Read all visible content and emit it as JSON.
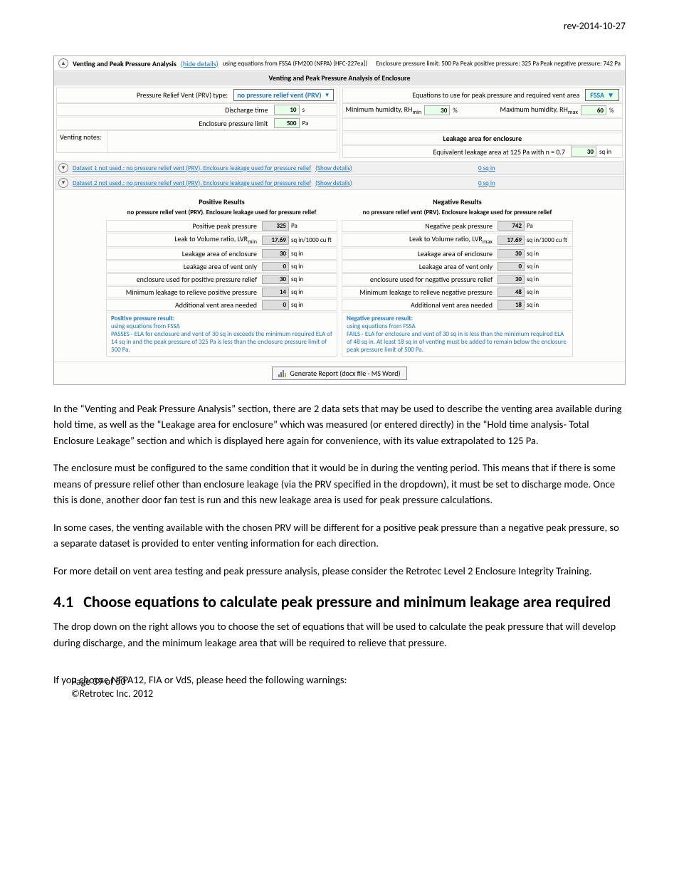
{
  "header": {
    "rev": "rev-2014-10-27"
  },
  "panel": {
    "titlebar": {
      "title": "Venting and Peak Pressure Analysis",
      "hide": "(hide details)",
      "eq_note": "using equations from FSSA (FM200 (NFPA) [HFC-227ea])",
      "summary": "Enclosure pressure limit: 500 Pa  Peak positive pressure: 325 Pa  Peak negative pressure: 742 Pa"
    },
    "banner": "Venting and Peak Pressure Analysis of Enclosure",
    "left": {
      "prv_label": "Pressure Relief Vent (PRV) type:",
      "prv_dropdown": "no pressure relief vent (PRV)",
      "discharge_label": "Discharge time",
      "discharge_val": "10",
      "discharge_unit": "s",
      "encl_label": "Enclosure pressure limit",
      "encl_val": "500",
      "encl_unit": "Pa",
      "venting_notes": "Venting notes:"
    },
    "right": {
      "eq_use_label": "Equations to use for peak pressure and required vent area",
      "eq_use_val": "FSSA",
      "min_rh_label": "Minimum humidity, RH",
      "min_rh_sub": "min",
      "min_rh_val": "30",
      "min_rh_unit": "%",
      "max_rh_label": "Maximum humidity, RH",
      "max_rh_sub": "max",
      "max_rh_val": "60",
      "max_rh_unit": "%",
      "leak_heading": "Leakage area for enclosure",
      "ela_label": "Equivalent leakage area at 125 Pa with n = 0.7",
      "ela_val": "30",
      "ela_unit": "sq in"
    },
    "datasets": {
      "d1": "Dataset 1 not used.: no pressure relief vent (PRV). Enclosure leakage used for pressure relief",
      "d2": "Dataset 2 not used.: no pressure relief vent (PRV). Enclosure leakage used for pressure relief",
      "show": "(Show details)",
      "zero": "0 sq in"
    },
    "results": {
      "pos_title": "Positive Results",
      "neg_title": "Negative Results",
      "sub": "no pressure relief vent (PRV). Enclosure leakage used for pressure relief",
      "pos": {
        "rows": [
          {
            "l": "Positive peak pressure",
            "v": "325",
            "u": "Pa"
          },
          {
            "l": "Leak to Volume ratio, LVR",
            "sub": "min",
            "v": "17.69",
            "u": "sq in/1000 cu ft"
          },
          {
            "l": "Leakage area of enclosure",
            "v": "30",
            "u": "sq in"
          },
          {
            "l": "Leakage area of vent only",
            "v": "0",
            "u": "sq in"
          },
          {
            "l": "enclosure  used for positive pressure relief",
            "v": "30",
            "u": "sq in"
          },
          {
            "l": "Minimum leakage to relieve positive pressure",
            "v": "14",
            "u": "sq in"
          },
          {
            "l": "Additional vent area needed",
            "v": "0",
            "u": "sq in"
          }
        ],
        "note_bold": "Positive pressure result:",
        "note_line1": "using equations from FSSA",
        "note_line2": "PASSES - ELA for enclosure and vent  of 30 sq in exceeds the minimum required ELA of 14 sq in and the peak pressure of 325 Pa is less than the enclosure pressure limit of 500 Pa."
      },
      "neg": {
        "rows": [
          {
            "l": "Negative peak pressure",
            "v": "742",
            "u": "Pa"
          },
          {
            "l": "Leak to Volume ratio, LVR",
            "sub": "max",
            "v": "17.69",
            "u": "sq in/1000 cu ft"
          },
          {
            "l": "Leakage area of enclosure",
            "v": "30",
            "u": "sq in"
          },
          {
            "l": "Leakage area of vent only",
            "v": "0",
            "u": "sq in"
          },
          {
            "l": "enclosure  used for negative pressure relief",
            "v": "30",
            "u": "sq in"
          },
          {
            "l": "Minimum leakage to relieve negative pressure",
            "v": "48",
            "u": "sq in"
          },
          {
            "l": "Additional vent area needed",
            "v": "18",
            "u": "sq in"
          }
        ],
        "note_bold": "Negative pressure result:",
        "note_line1": "using equations from FSSA",
        "note_line2": "FAILS - ELA for enclosure and vent  of 30 sq in is less than the minimum required ELA of 48 sq in.  At least 18 sq in of venting must be added to remain below the enclosure peak pressure limit of 500 Pa."
      }
    },
    "gen_button": "Generate Report (docx file - MS Word)"
  },
  "body": {
    "p1": "In the “Venting and Peak Pressure Analysis” section, there are 2 data sets that may be used to describe the venting area available during hold time, as well as the “Leakage area for enclosure” which was measured (or entered directly) in the “Hold time analysis- Total Enclosure Leakage” section and which is displayed here again for convenience, with its value extrapolated to 125 Pa.",
    "p2": "The enclosure must be configured to the same condition that it would be in during the venting period. This means that if there is some means of pressure relief other than enclosure leakage (via the PRV specified in the dropdown), it must be set to discharge mode.  Once this is done, another door fan test is run and this new leakage area is used for peak pressure calculations.",
    "p3": "In some cases, the venting available with the chosen PRV will be different for a positive peak pressure than a negative peak pressure, so a separate dataset is provided to enter venting information for each direction.",
    "p4": "For more detail  on vent area testing and peak pressure analysis, please consider the Retrotec Level 2 Enclosure Integrity Training.",
    "h41_num": "4.1",
    "h41_text": "Choose equations to calculate peak pressure and minimum leakage area required",
    "p5": "The drop down on the right allows you to choose the set of equations that will be used to calculate the peak pressure that will develop during discharge, and the minimum leakage area that will be required to relieve that pressure.",
    "p6": "If you choose NFPA12, FIA or VdS, please heed the following warnings:"
  },
  "footer": {
    "page": "Page 39 of 50",
    "copyright": "©Retrotec Inc. 2012"
  }
}
